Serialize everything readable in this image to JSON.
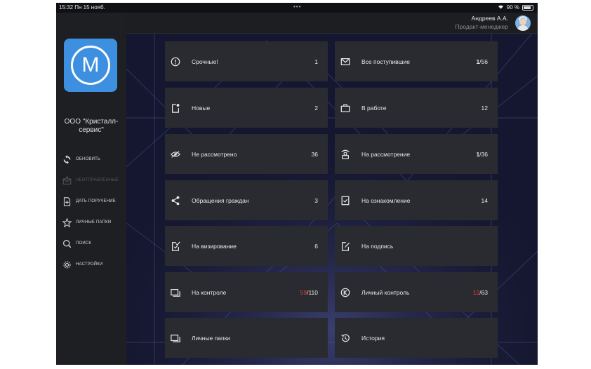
{
  "status": {
    "time": "15:32",
    "date": "Пн 15 нояб.",
    "battery": "90 %"
  },
  "sidebar": {
    "logo_letter": "M",
    "company": "ООО \"Кристалл-сервис\"",
    "items": [
      {
        "label": "обновить",
        "icon": "refresh-icon",
        "enabled": true
      },
      {
        "label": "неотправленные",
        "icon": "outbox-icon",
        "enabled": false
      },
      {
        "label": "дать поручение",
        "icon": "assign-task-icon",
        "enabled": true
      },
      {
        "label": "личные папки",
        "icon": "star-icon",
        "enabled": true
      },
      {
        "label": "поиск",
        "icon": "search-icon",
        "enabled": true
      },
      {
        "label": "настройки",
        "icon": "gear-icon",
        "enabled": true
      }
    ]
  },
  "user": {
    "name": "Андреев А.А.",
    "role": "Продакт-менеджер"
  },
  "tiles_left": [
    {
      "label": "Срочные!",
      "count": "1",
      "icon": "alert-icon"
    },
    {
      "label": "Новые",
      "count": "2",
      "icon": "new-doc-icon"
    },
    {
      "label": "Не рассмотрено",
      "count": "36",
      "icon": "eye-off-icon"
    },
    {
      "label": "Обращения граждан",
      "count": "3",
      "icon": "share-icon"
    },
    {
      "label": "На визирование",
      "count": "6",
      "icon": "visa-icon"
    },
    {
      "label": "На контроле",
      "count_red": "59",
      "count_rest": "/110",
      "icon": "folders-icon"
    },
    {
      "label": "Личные папки",
      "count": "",
      "icon": "personal-folders-icon"
    }
  ],
  "tiles_right": [
    {
      "label": "Все поступившие",
      "count_bold": "1",
      "count_rest": "/56",
      "icon": "mail-icon"
    },
    {
      "label": "В работе",
      "count": "12",
      "icon": "briefcase-icon"
    },
    {
      "label": "На рассмотрение",
      "count_bold": "1",
      "count_rest": "/36",
      "icon": "review-icon"
    },
    {
      "label": "На ознакомление",
      "count": "14",
      "icon": "check-doc-icon"
    },
    {
      "label": "На подпись",
      "count": "",
      "icon": "sign-icon"
    },
    {
      "label": "Личный контроль",
      "count_red": "12",
      "count_rest": "/63",
      "icon": "personal-control-icon"
    },
    {
      "label": "История",
      "count": "",
      "icon": "history-icon"
    }
  ],
  "colors": {
    "accent": "#3d8fe0",
    "tile": "#2a2b30",
    "alert": "#e54040"
  }
}
